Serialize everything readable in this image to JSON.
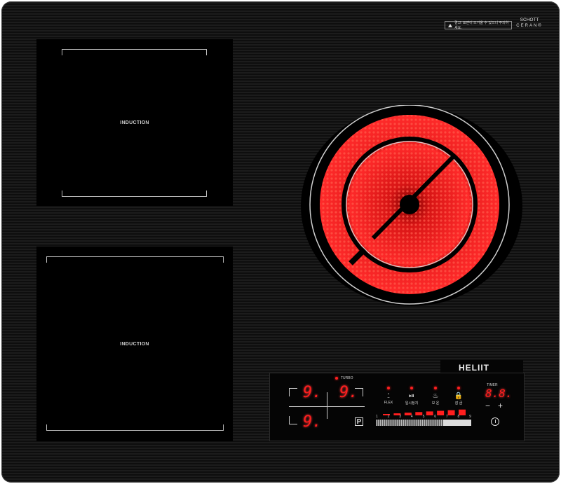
{
  "cooktop": {
    "zones": [
      {
        "id": "front-left",
        "label": "INDUCTION"
      },
      {
        "id": "rear-left",
        "label": "INDUCTION"
      }
    ],
    "radiant_zone": {
      "state": "glowing",
      "color": "#ff1d1d"
    }
  },
  "branding": {
    "warning_text": "경고: 표면이 뜨거울 수 있으니 주의하세요.",
    "glass_maker_line1": "SCHOTT",
    "glass_maker_line2": "CERAN®",
    "brand_name": "HELIIT"
  },
  "control_panel": {
    "turbo_label": "TURBO",
    "zone_displays": [
      {
        "id": "top-left",
        "value": "9."
      },
      {
        "id": "top-right",
        "value": "9."
      },
      {
        "id": "bottom-left",
        "value": "9."
      }
    ],
    "pause_button": "P",
    "functions": [
      {
        "icon": "flex-icon",
        "glyph": "⍘",
        "label": "FLEX"
      },
      {
        "icon": "play-pause-icon",
        "glyph": "⏯",
        "label": "일시정지"
      },
      {
        "icon": "keep-warm-icon",
        "glyph": "♨",
        "label": "보 온"
      },
      {
        "icon": "lock-icon",
        "glyph": "🔒",
        "label": "잠 금"
      }
    ],
    "slider": {
      "ticks": [
        "1",
        "2",
        "3",
        "4",
        "5",
        "6",
        "7",
        "8",
        "9"
      ],
      "level": 9
    },
    "timer": {
      "label": "TIMER",
      "value": "8.8.",
      "minus": "−",
      "plus": "+"
    },
    "accent_color": "#ff1e1e"
  }
}
